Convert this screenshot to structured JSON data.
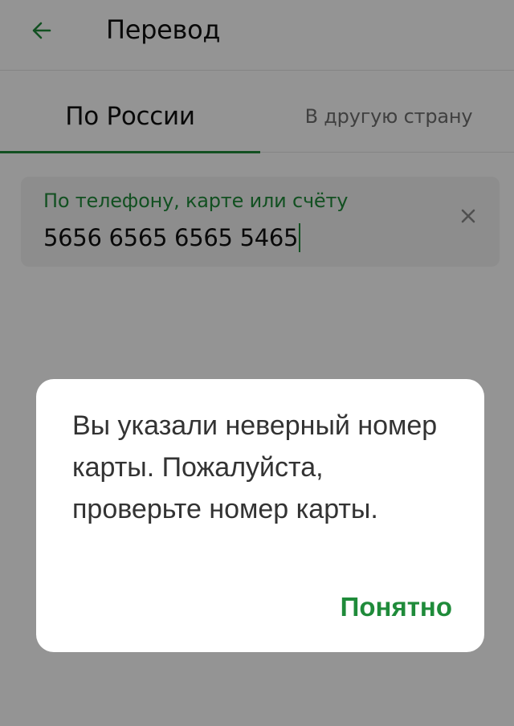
{
  "header": {
    "title": "Перевод",
    "back_icon": "arrow-left-icon"
  },
  "tabs": [
    {
      "label": "По России",
      "active": true
    },
    {
      "label": "В другую страну",
      "active": false
    }
  ],
  "field": {
    "label": "По телефону, карте или счёту",
    "value": "5656 6565 6565 5465",
    "clear_icon": "close-icon"
  },
  "dialog": {
    "message": "Вы указали неверный номер карты. Пожалуйста, проверьте номер карты.",
    "button_label": "Понятно"
  },
  "colors": {
    "accent": "#1f8b3a",
    "overlay": "rgba(0,0,0,0.42)",
    "field_bg": "#f3f3f3"
  }
}
